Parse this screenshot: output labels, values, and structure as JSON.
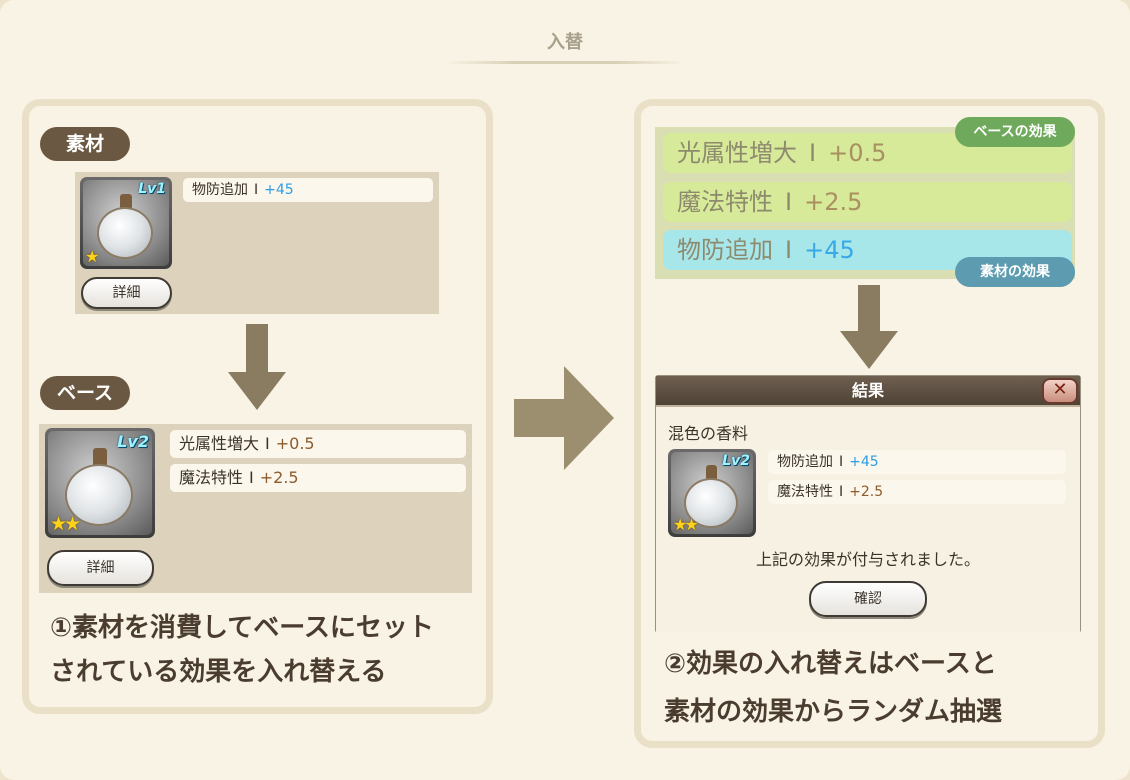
{
  "page": {
    "title": "入替"
  },
  "left": {
    "material_label": "素材",
    "material_item": {
      "level": "Lv1",
      "stars": "★"
    },
    "material_stats": [
      {
        "name": "物防追加",
        "sep": "I",
        "value": "+45",
        "color": "blue"
      }
    ],
    "material_detail": "詳細",
    "base_label": "ベース",
    "base_item": {
      "level": "Lv2",
      "stars": "★★"
    },
    "base_stats": [
      {
        "name": "光属性増大",
        "sep": "I",
        "value": "+0.5",
        "color": "brown"
      },
      {
        "name": "魔法特性",
        "sep": "I",
        "value": "+2.5",
        "color": "brown"
      }
    ],
    "base_detail": "詳細",
    "caption_line1": "①素材を消費してベースにセット",
    "caption_line2": "されている効果を入れ替える"
  },
  "right": {
    "effects": [
      {
        "name": "光属性増大",
        "sep": "I",
        "value": "+0.5",
        "kind": "base"
      },
      {
        "name": "魔法特性",
        "sep": "I",
        "value": "+2.5",
        "kind": "base"
      },
      {
        "name": "物防追加",
        "sep": "I",
        "value": "+45",
        "kind": "material"
      }
    ],
    "base_tag": "ベースの効果",
    "material_tag": "素材の効果",
    "dialog": {
      "title": "結果",
      "close": "✕",
      "item_name": "混色の香料",
      "item": {
        "level": "Lv2",
        "stars": "★★"
      },
      "stats": [
        {
          "name": "物防追加",
          "sep": "I",
          "value": "+45"
        },
        {
          "name": "魔法特性",
          "sep": "I",
          "value": "+2.5"
        }
      ],
      "message": "上記の効果が付与されました。",
      "confirm": "確認"
    },
    "caption_line1": "②効果の入れ替えはベースと",
    "caption_line2": "素材の効果からランダム抽選"
  },
  "colors": {
    "background": "#f8f3e4",
    "panel_border": "#e9e0c7",
    "label_pill": "#6b5842",
    "arrow": "#8a7c60",
    "base_tag": "#6faa5c",
    "material_tag": "#5c9bb0",
    "value_blue": "#2b9ee6",
    "value_brown": "#8d5b2c"
  },
  "icons": [
    "arrow-down-icon",
    "arrow-right-icon",
    "close-icon",
    "star-icon",
    "perfume-flask-icon"
  ]
}
